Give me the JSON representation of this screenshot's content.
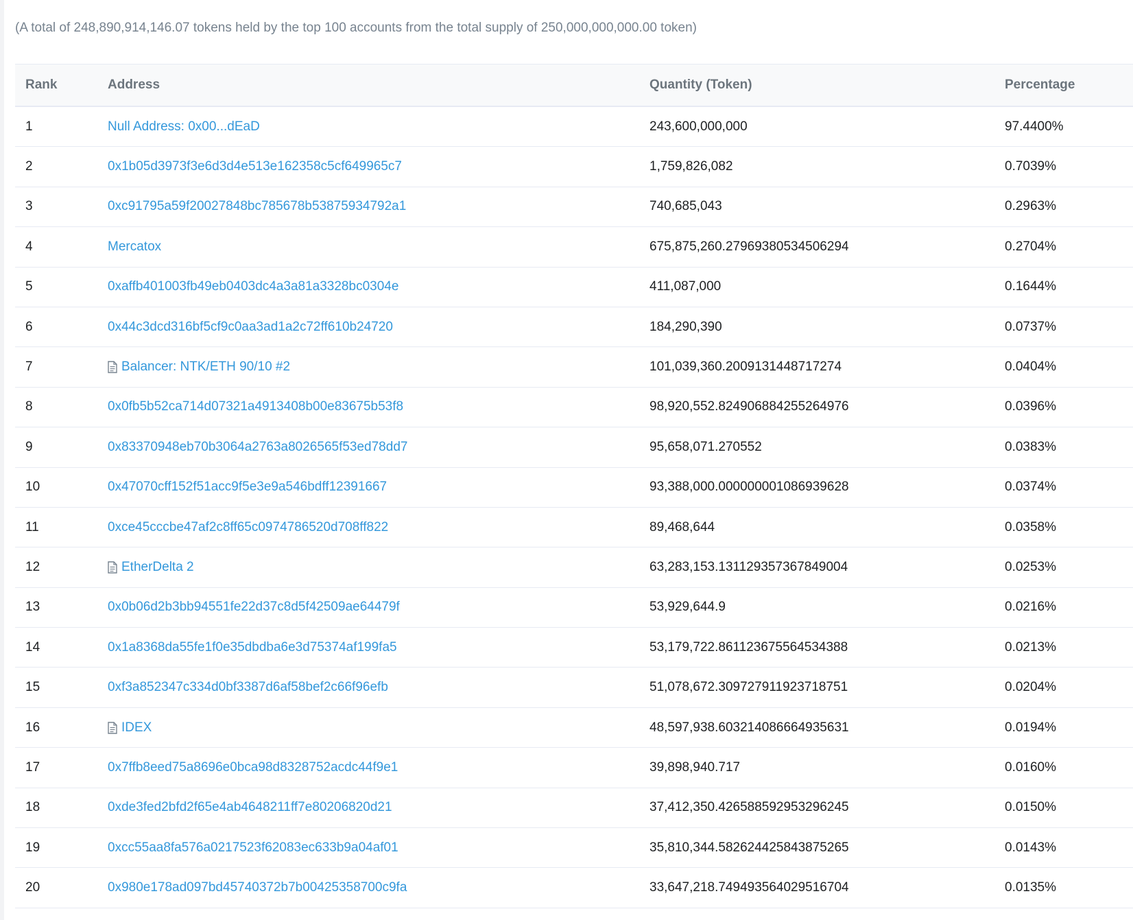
{
  "summary": "(A total of 248,890,914,146.07 tokens held by the top 100 accounts from the total supply of 250,000,000,000.00 token)",
  "colors": {
    "link": "#3498db",
    "header_text": "#6c757d",
    "summary_text": "#77838f",
    "border": "#e7eaf3"
  },
  "table": {
    "headers": {
      "rank": "Rank",
      "address": "Address",
      "quantity": "Quantity (Token)",
      "percentage": "Percentage"
    },
    "rows": [
      {
        "rank": "1",
        "address": "Null Address: 0x00...dEaD",
        "contract": false,
        "quantity": "243,600,000,000",
        "percentage": "97.4400%"
      },
      {
        "rank": "2",
        "address": "0x1b05d3973f3e6d3d4e513e162358c5cf649965c7",
        "contract": false,
        "quantity": "1,759,826,082",
        "percentage": "0.7039%"
      },
      {
        "rank": "3",
        "address": "0xc91795a59f20027848bc785678b53875934792a1",
        "contract": false,
        "quantity": "740,685,043",
        "percentage": "0.2963%"
      },
      {
        "rank": "4",
        "address": "Mercatox",
        "contract": false,
        "quantity": "675,875,260.27969380534506294",
        "percentage": "0.2704%"
      },
      {
        "rank": "5",
        "address": "0xaffb401003fb49eb0403dc4a3a81a3328bc0304e",
        "contract": false,
        "quantity": "411,087,000",
        "percentage": "0.1644%"
      },
      {
        "rank": "6",
        "address": "0x44c3dcd316bf5cf9c0aa3ad1a2c72ff610b24720",
        "contract": false,
        "quantity": "184,290,390",
        "percentage": "0.0737%"
      },
      {
        "rank": "7",
        "address": "Balancer: NTK/ETH 90/10 #2",
        "contract": true,
        "quantity": "101,039,360.2009131448717274",
        "percentage": "0.0404%"
      },
      {
        "rank": "8",
        "address": "0x0fb5b52ca714d07321a4913408b00e83675b53f8",
        "contract": false,
        "quantity": "98,920,552.824906884255264976",
        "percentage": "0.0396%"
      },
      {
        "rank": "9",
        "address": "0x83370948eb70b3064a2763a8026565f53ed78dd7",
        "contract": false,
        "quantity": "95,658,071.270552",
        "percentage": "0.0383%"
      },
      {
        "rank": "10",
        "address": "0x47070cff152f51acc9f5e3e9a546bdff12391667",
        "contract": false,
        "quantity": "93,388,000.000000001086939628",
        "percentage": "0.0374%"
      },
      {
        "rank": "11",
        "address": "0xce45cccbe47af2c8ff65c0974786520d708ff822",
        "contract": false,
        "quantity": "89,468,644",
        "percentage": "0.0358%"
      },
      {
        "rank": "12",
        "address": "EtherDelta 2",
        "contract": true,
        "quantity": "63,283,153.131129357367849004",
        "percentage": "0.0253%"
      },
      {
        "rank": "13",
        "address": "0x0b06d2b3bb94551fe22d37c8d5f42509ae64479f",
        "contract": false,
        "quantity": "53,929,644.9",
        "percentage": "0.0216%"
      },
      {
        "rank": "14",
        "address": "0x1a8368da55fe1f0e35dbdba6e3d75374af199fa5",
        "contract": false,
        "quantity": "53,179,722.861123675564534388",
        "percentage": "0.0213%"
      },
      {
        "rank": "15",
        "address": "0xf3a852347c334d0bf3387d6af58bef2c66f96efb",
        "contract": false,
        "quantity": "51,078,672.309727911923718751",
        "percentage": "0.0204%"
      },
      {
        "rank": "16",
        "address": "IDEX",
        "contract": true,
        "quantity": "48,597,938.603214086664935631",
        "percentage": "0.0194%"
      },
      {
        "rank": "17",
        "address": "0x7ffb8eed75a8696e0bca98d8328752acdc44f9e1",
        "contract": false,
        "quantity": "39,898,940.717",
        "percentage": "0.0160%"
      },
      {
        "rank": "18",
        "address": "0xde3fed2bfd2f65e4ab4648211ff7e80206820d21",
        "contract": false,
        "quantity": "37,412,350.426588592953296245",
        "percentage": "0.0150%"
      },
      {
        "rank": "19",
        "address": "0xcc55aa8fa576a0217523f62083ec633b9a04af01",
        "contract": false,
        "quantity": "35,810,344.582624425843875265",
        "percentage": "0.0143%"
      },
      {
        "rank": "20",
        "address": "0x980e178ad097bd45740372b7b00425358700c9fa",
        "contract": false,
        "quantity": "33,647,218.749493564029516704",
        "percentage": "0.0135%"
      }
    ]
  }
}
